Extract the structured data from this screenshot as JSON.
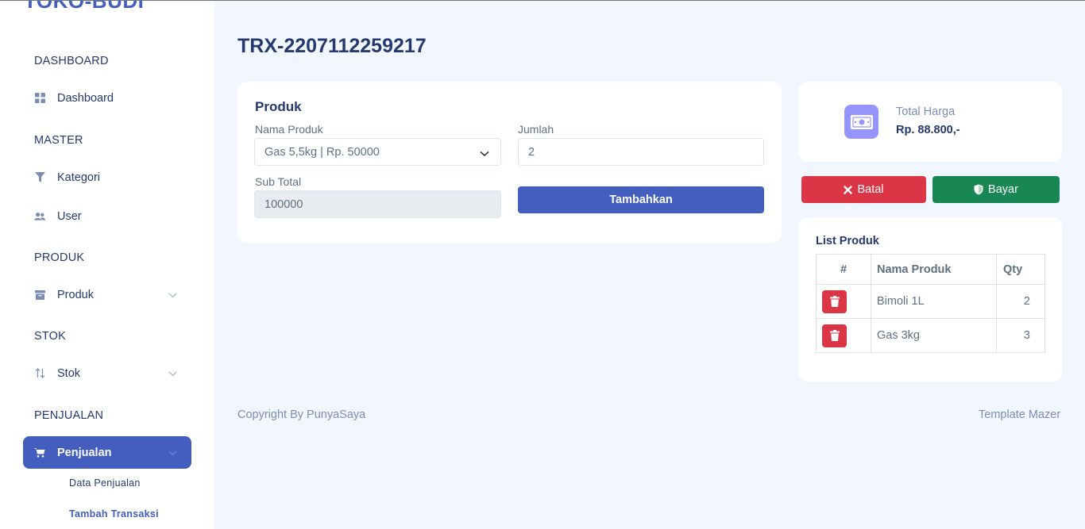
{
  "sidebar": {
    "logo": "TOKO-BUDI",
    "sections": [
      {
        "title": "DASHBOARD"
      },
      {
        "title": "MASTER"
      },
      {
        "title": "PRODUK"
      },
      {
        "title": "STOK"
      },
      {
        "title": "PENJUALAN"
      }
    ],
    "items": {
      "dashboard": {
        "label": "Dashboard",
        "icon": "grid-icon"
      },
      "kategori": {
        "label": "Kategori",
        "icon": "filter-icon"
      },
      "user": {
        "label": "User",
        "icon": "people-icon"
      },
      "produk": {
        "label": "Produk",
        "icon": "archive-icon"
      },
      "stok": {
        "label": "Stok",
        "icon": "sort-arrows-icon"
      },
      "penjualan": {
        "label": "Penjualan",
        "icon": "cart-icon"
      }
    },
    "submenu": [
      {
        "label": "Data Penjualan"
      },
      {
        "label": "Tambah Transaksi"
      }
    ]
  },
  "page": {
    "title": "TRX-2207112259217"
  },
  "produk_card": {
    "heading": "Produk",
    "nama_produk_label": "Nama Produk",
    "nama_produk_value": "Gas 5,5kg | Rp. 50000",
    "jumlah_label": "Jumlah",
    "jumlah_value": "2",
    "subtotal_label": "Sub Total",
    "subtotal_value": "100000",
    "add_button": "Tambahkan"
  },
  "total_card": {
    "label": "Total Harga",
    "value": "Rp. 88.800,-",
    "icon": "money-icon"
  },
  "actions": {
    "cancel_label": "Batal",
    "pay_label": "Bayar"
  },
  "list_card": {
    "title": "List Produk",
    "headers": {
      "hash": "#",
      "name": "Nama Produk",
      "qty": "Qty"
    },
    "rows": [
      {
        "name": "Bimoli 1L",
        "qty": "2"
      },
      {
        "name": "Gas 3kg",
        "qty": "3"
      }
    ]
  },
  "footer": {
    "left": "Copyright By PunyaSaya",
    "right": "Template Mazer"
  },
  "colors": {
    "primary": "#435ebe",
    "danger": "#dc3545",
    "success": "#198754",
    "background": "#f2f7ff"
  }
}
